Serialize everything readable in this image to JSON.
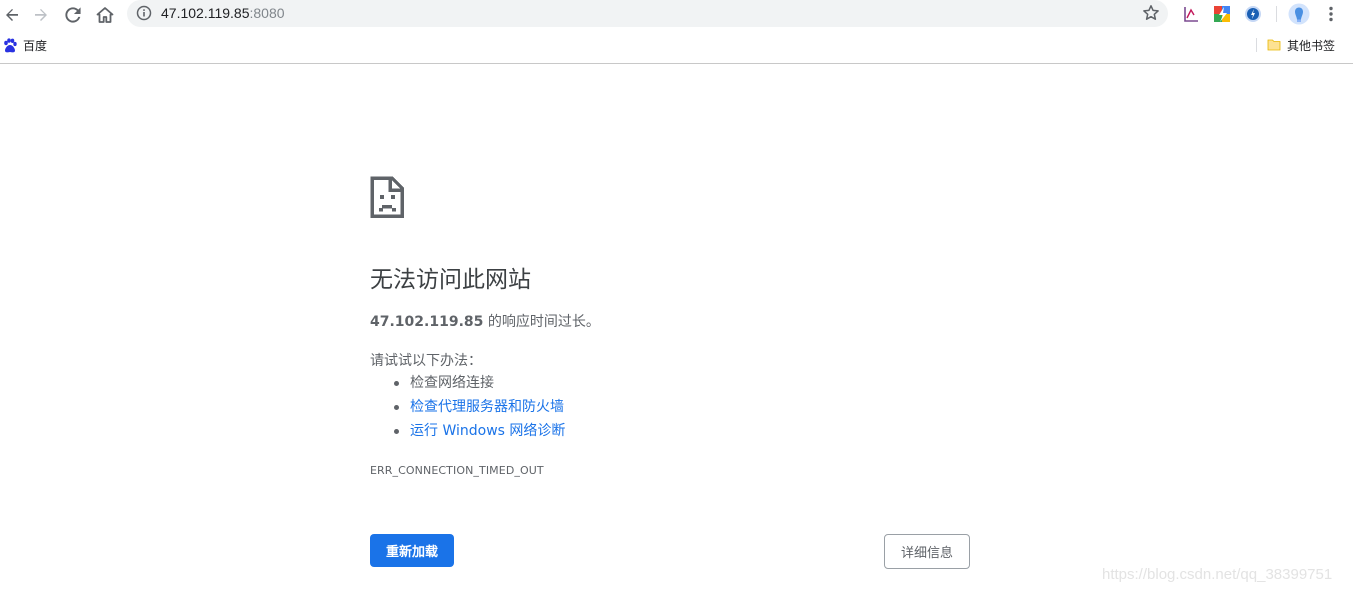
{
  "toolbar": {
    "back_icon": "back-arrow-icon",
    "forward_icon": "forward-arrow-icon",
    "reload_icon": "reload-icon",
    "home_icon": "home-icon",
    "url_host": "47.102.119.85",
    "url_port": ":8080",
    "info_icon": "info-icon",
    "star_icon": "star-icon",
    "menu_icon": "three-dot-menu-icon"
  },
  "bookmarks": {
    "baidu_label": "百度",
    "other_label": "其他书签"
  },
  "error": {
    "title": "无法访问此网站",
    "host": "47.102.119.85",
    "desc_suffix": " 的响应时间过长。",
    "try_label": "请试试以下办法：",
    "suggestions": [
      "检查网络连接",
      "检查代理服务器和防火墙",
      "运行 Windows 网络诊断"
    ],
    "code": "ERR_CONNECTION_TIMED_OUT",
    "reload_label": "重新加载",
    "details_label": "详细信息"
  },
  "watermark": "https://blog.csdn.net/qq_38399751",
  "colors": {
    "accent": "#1a73e8",
    "text_secondary": "#5f6368",
    "title": "#3c4043"
  }
}
